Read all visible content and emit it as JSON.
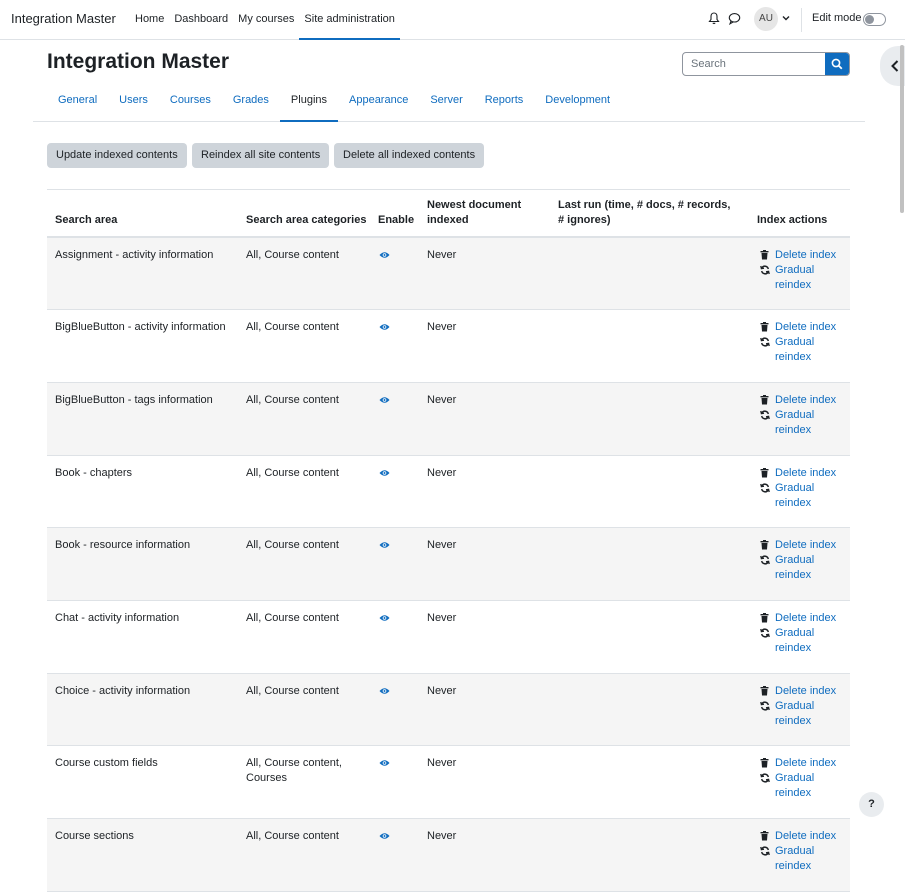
{
  "navbar": {
    "brand": "Integration Master",
    "links": [
      "Home",
      "Dashboard",
      "My courses",
      "Site administration"
    ],
    "active_link": "Site administration",
    "avatar_initials": "AU",
    "edit_mode_label": "Edit mode"
  },
  "header": {
    "title": "Integration Master",
    "search_placeholder": "Search"
  },
  "secondary_nav": {
    "tabs": [
      "General",
      "Users",
      "Courses",
      "Grades",
      "Plugins",
      "Appearance",
      "Server",
      "Reports",
      "Development"
    ],
    "active_tab": "Plugins"
  },
  "buttons": {
    "update": "Update indexed contents",
    "reindex": "Reindex all site contents",
    "delete_all": "Delete all indexed contents"
  },
  "table": {
    "headers": {
      "search_area": "Search area",
      "categories": "Search area categories",
      "enable": "Enable",
      "newest": "Newest document indexed",
      "last_run": "Last run (time, # docs, # records, # ignores)",
      "actions": "Index actions"
    },
    "action_labels": {
      "delete": "Delete index",
      "gradual": "Gradual reindex"
    },
    "rows": [
      {
        "area": "Assignment - activity information",
        "categories": "All, Course content",
        "newest": "Never"
      },
      {
        "area": "BigBlueButton - activity information",
        "categories": "All, Course content",
        "newest": "Never"
      },
      {
        "area": "BigBlueButton - tags information",
        "categories": "All, Course content",
        "newest": "Never"
      },
      {
        "area": "Book - chapters",
        "categories": "All, Course content",
        "newest": "Never"
      },
      {
        "area": "Book - resource information",
        "categories": "All, Course content",
        "newest": "Never"
      },
      {
        "area": "Chat - activity information",
        "categories": "All, Course content",
        "newest": "Never"
      },
      {
        "area": "Choice - activity information",
        "categories": "All, Course content",
        "newest": "Never"
      },
      {
        "area": "Course custom fields",
        "categories": "All, Course content, Courses",
        "newest": "Never"
      },
      {
        "area": "Course sections",
        "categories": "All, Course content",
        "newest": "Never"
      }
    ]
  },
  "help_button": "?",
  "colors": {
    "link": "#0f6cbf",
    "primary": "#0f6cbf",
    "button_bg": "#ced4da",
    "striped_row": "#f5f5f5"
  }
}
